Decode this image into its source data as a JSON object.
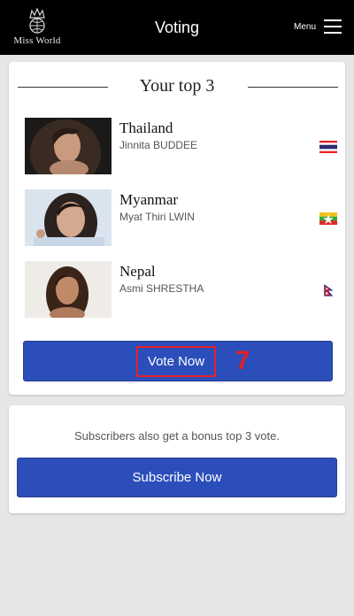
{
  "header": {
    "logo_text": "Miss World",
    "title": "Voting",
    "menu_label": "Menu"
  },
  "top3": {
    "heading": "Your top 3",
    "entries": [
      {
        "country": "Thailand",
        "name": "Jinnita BUDDEE",
        "flag": "thailand-flag"
      },
      {
        "country": "Myanmar",
        "name": "Myat Thiri LWIN",
        "flag": "myanmar-flag"
      },
      {
        "country": "Nepal",
        "name": "Asmi SHRESTHA",
        "flag": "nepal-flag"
      }
    ],
    "vote_button": "Vote Now",
    "step_number": "7"
  },
  "subscribe": {
    "text": "Subscribers also get a bonus top 3 vote.",
    "button": "Subscribe Now"
  },
  "colors": {
    "header_bg": "#000000",
    "button_blue": "#2b4eba",
    "highlight_red": "#e8202a",
    "page_bg": "#e6e6e6"
  }
}
